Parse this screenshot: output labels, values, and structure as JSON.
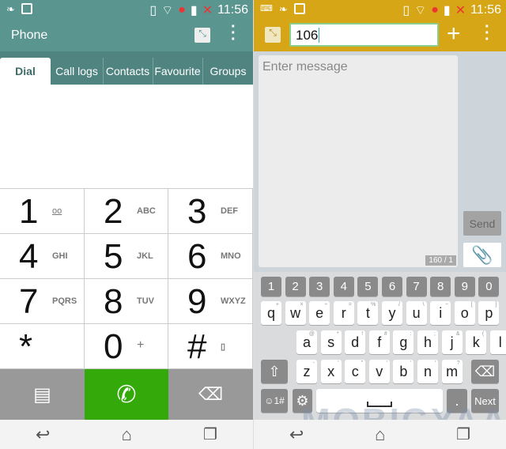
{
  "status": {
    "time": "11:56"
  },
  "phone": {
    "title": "Phone",
    "tabs": [
      "Dial",
      "Call logs",
      "Contacts",
      "Favourite",
      "Groups"
    ],
    "active_tab": "Dial",
    "keys": [
      [
        "1",
        "voicemail"
      ],
      [
        "2",
        "ABC"
      ],
      [
        "3",
        "DEF"
      ],
      [
        "4",
        "GHI"
      ],
      [
        "5",
        "JKL"
      ],
      [
        "6",
        "MNO"
      ],
      [
        "7",
        "PQRS"
      ],
      [
        "8",
        "TUV"
      ],
      [
        "9",
        "WXYZ"
      ],
      [
        "*",
        ""
      ],
      [
        "0",
        "+"
      ],
      [
        "#",
        "vibrate"
      ]
    ],
    "call_color": "#33aa0a",
    "header_color": "#5a9590"
  },
  "messaging": {
    "recipient": "106",
    "message_placeholder": "Enter message",
    "counter": "160 / 1",
    "send_label": "Send",
    "header_color": "#d6a616"
  },
  "keyboard": {
    "numbers": [
      "1",
      "2",
      "3",
      "4",
      "5",
      "6",
      "7",
      "8",
      "9",
      "0"
    ],
    "row1": [
      [
        "q",
        "+"
      ],
      [
        "w",
        "×"
      ],
      [
        "e",
        "÷"
      ],
      [
        "r",
        "="
      ],
      [
        "t",
        "%"
      ],
      [
        "y",
        "/"
      ],
      [
        "u",
        "\\"
      ],
      [
        "i",
        "~"
      ],
      [
        "o",
        "["
      ],
      [
        "p",
        "]"
      ]
    ],
    "row2": [
      [
        "a",
        "@"
      ],
      [
        "s",
        "*"
      ],
      [
        "d",
        "!"
      ],
      [
        "f",
        "#"
      ],
      [
        "g",
        ":"
      ],
      [
        "h",
        ";"
      ],
      [
        "j",
        "&"
      ],
      [
        "k",
        "("
      ],
      [
        "l",
        ")"
      ]
    ],
    "row3": [
      [
        "z",
        "-"
      ],
      [
        "x",
        "'"
      ],
      [
        "c",
        "\""
      ],
      [
        "v",
        "'"
      ],
      [
        "b",
        "'"
      ],
      [
        "n",
        "'"
      ],
      [
        "m",
        "?"
      ]
    ],
    "symbols_label": "☺1#",
    "period_label": ".",
    "next_label": "Next"
  },
  "watermark": "MOBIGYAAN"
}
